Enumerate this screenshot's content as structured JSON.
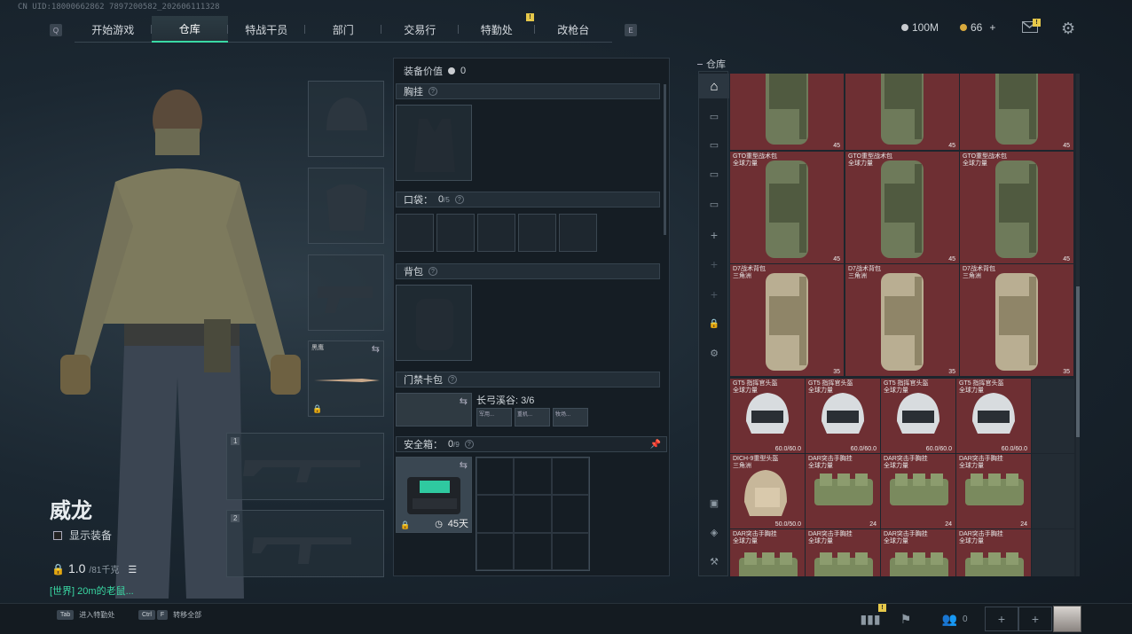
{
  "uid": "CN UID:18000662862 7897200582_202606111328",
  "nav": {
    "left_key": "Q",
    "right_key": "E",
    "tabs": [
      "开始游戏",
      "仓库",
      "特战干员",
      "部门",
      "交易行",
      "特勤处",
      "改枪台"
    ],
    "active_tab": "仓库",
    "tab_badge": "!"
  },
  "currency": {
    "money": "100M",
    "coins": "66",
    "plus": "+",
    "mail_badge": "!"
  },
  "character": {
    "name": "威龙",
    "show_gear": "显示装备",
    "weight": "1.0",
    "weight_limit": "/81千克",
    "chat": "[世界] 20m的老鼠..."
  },
  "loadout": {
    "melee_label": "黑鹰",
    "primary_index": "1",
    "secondary_index": "2"
  },
  "equip": {
    "value_label": "装备价值",
    "value": "0",
    "chest_rig": "胸挂",
    "pockets_label": "口袋：",
    "pockets_count": "0",
    "pockets_cap": "/5",
    "backpack": "背包",
    "keycard": "门禁卡包",
    "keycard_text": "长弓溪谷: 3/6",
    "key_slots": [
      "军用...",
      "重机...",
      "牧场..."
    ],
    "safe_label": "安全箱：",
    "safe_count": "0",
    "safe_cap": "/9",
    "safe_days": "45天"
  },
  "warehouse": {
    "title": "仓库",
    "rows": [
      [
        {
          "name": "",
          "sub": "",
          "count": "45"
        },
        {
          "name": "",
          "sub": "",
          "count": "45"
        },
        {
          "name": "",
          "sub": "",
          "count": "45"
        }
      ],
      [
        {
          "name": "GTO重型战术包",
          "sub": "全球力量",
          "count": "45"
        },
        {
          "name": "GTO重型战术包",
          "sub": "全球力量",
          "count": "45"
        },
        {
          "name": "GTO重型战术包",
          "sub": "全球力量",
          "count": "45"
        }
      ],
      [
        {
          "name": "D7战术背包",
          "sub": "三角洲",
          "count": "35"
        },
        {
          "name": "D7战术背包",
          "sub": "三角洲",
          "count": "35"
        },
        {
          "name": "D7战术背包",
          "sub": "三角洲",
          "count": "35"
        }
      ]
    ],
    "helmets": [
      {
        "name": "GT5 指挥官头盔",
        "sub": "全球力量",
        "dur": "60.0/60.0"
      },
      {
        "name": "GT5 指挥官头盔",
        "sub": "全球力量",
        "dur": "60.0/60.0"
      },
      {
        "name": "GT5 指挥官头盔",
        "sub": "全球力量",
        "dur": "60.0/60.0"
      },
      {
        "name": "GT5 指挥官头盔",
        "sub": "全球力量",
        "dur": "60.0/60.0"
      }
    ],
    "rigs": [
      {
        "name": "DICH-9重型头盔",
        "sub": "三角洲",
        "val": "50.0/50.0"
      },
      {
        "name": "DAR突击手胸挂",
        "sub": "全球力量",
        "val": "24"
      },
      {
        "name": "DAR突击手胸挂",
        "sub": "全球力量",
        "val": "24"
      },
      {
        "name": "DAR突击手胸挂",
        "sub": "全球力量",
        "val": "24"
      }
    ],
    "rigs2": [
      {
        "name": "DAR突击手胸挂",
        "sub": "全球力量"
      },
      {
        "name": "DAR突击手胸挂",
        "sub": "全球力量"
      },
      {
        "name": "DAR突击手胸挂",
        "sub": "全球力量"
      },
      {
        "name": "DAR突击手胸挂",
        "sub": "全球力量"
      }
    ]
  },
  "bottom": {
    "tab_key": "Tab",
    "tab_action": "进入特勤处",
    "ctrl_key": "Ctrl",
    "f_key": "F",
    "transfer_action": "转移全部",
    "friends": "0",
    "stats_badge": "!"
  }
}
